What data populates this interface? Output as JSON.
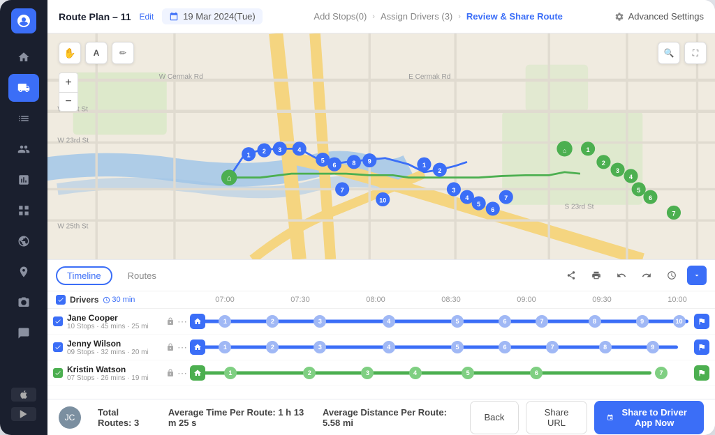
{
  "sidebar": {
    "logo_label": "U",
    "items": [
      {
        "name": "home",
        "icon": "⌂",
        "active": false
      },
      {
        "name": "route",
        "icon": "⊞",
        "active": true
      },
      {
        "name": "list",
        "icon": "☰",
        "active": false
      },
      {
        "name": "person",
        "icon": "👤",
        "active": false
      },
      {
        "name": "chart",
        "icon": "📊",
        "active": false
      },
      {
        "name": "grid",
        "icon": "▦",
        "active": false
      },
      {
        "name": "globe",
        "icon": "◎",
        "active": false
      },
      {
        "name": "pin",
        "icon": "◇",
        "active": false
      },
      {
        "name": "camera",
        "icon": "▣",
        "active": false
      },
      {
        "name": "chat",
        "icon": "💬",
        "active": false
      }
    ]
  },
  "header": {
    "title": "Route Plan – 11",
    "edit_label": "Edit",
    "date_icon": "📅",
    "date": "19 Mar 2024(Tue)",
    "steps": [
      {
        "label": "Add Stops(0)",
        "active": false
      },
      {
        "label": "Assign Drivers (3)",
        "active": false
      },
      {
        "label": "Review & Share Route",
        "active": true
      }
    ],
    "settings_label": "Advanced Settings"
  },
  "map": {
    "zoom_in": "+",
    "zoom_out": "−"
  },
  "timeline": {
    "tabs": [
      {
        "label": "Timeline",
        "active": true
      },
      {
        "label": "Routes",
        "active": false
      }
    ],
    "tools": [
      "share",
      "print",
      "undo",
      "redo",
      "clock",
      "chevron"
    ],
    "header_row": {
      "drivers_label": "Drivers",
      "duration": "30 min",
      "time_slots": [
        "07:00",
        "07:30",
        "08:00",
        "08:30",
        "09:00",
        "09:30",
        "10:00"
      ]
    },
    "drivers": [
      {
        "name": "Jane Cooper",
        "meta": "10 Stops · 45 mins · 25 mi",
        "color": "#3b6ef7",
        "stops": [
          "1",
          "2",
          "3",
          "4",
          "5",
          "6",
          "7",
          "8",
          "9",
          "10"
        ]
      },
      {
        "name": "Jenny Wilson",
        "meta": "09 Stops · 32 mins · 20 mi",
        "color": "#3b6ef7",
        "stops": [
          "1",
          "2",
          "3",
          "4",
          "5",
          "6",
          "7",
          "8",
          "9"
        ]
      },
      {
        "name": "Kristin Watson",
        "meta": "07 Stops · 26 mins · 19 mi",
        "color": "#4caf50",
        "stops": [
          "1",
          "2",
          "3",
          "4",
          "5",
          "6",
          "7"
        ]
      }
    ]
  },
  "footer": {
    "total_routes_label": "Total Routes:",
    "total_routes_value": "3",
    "avg_time_label": "Average Time Per Route:",
    "avg_time_value": "1 h 13 m 25 s",
    "avg_dist_label": "Average Distance Per Route:",
    "avg_dist_value": "5.58 mi",
    "back_label": "Back",
    "share_url_label": "Share URL",
    "share_app_label": "Share to Driver App Now"
  }
}
